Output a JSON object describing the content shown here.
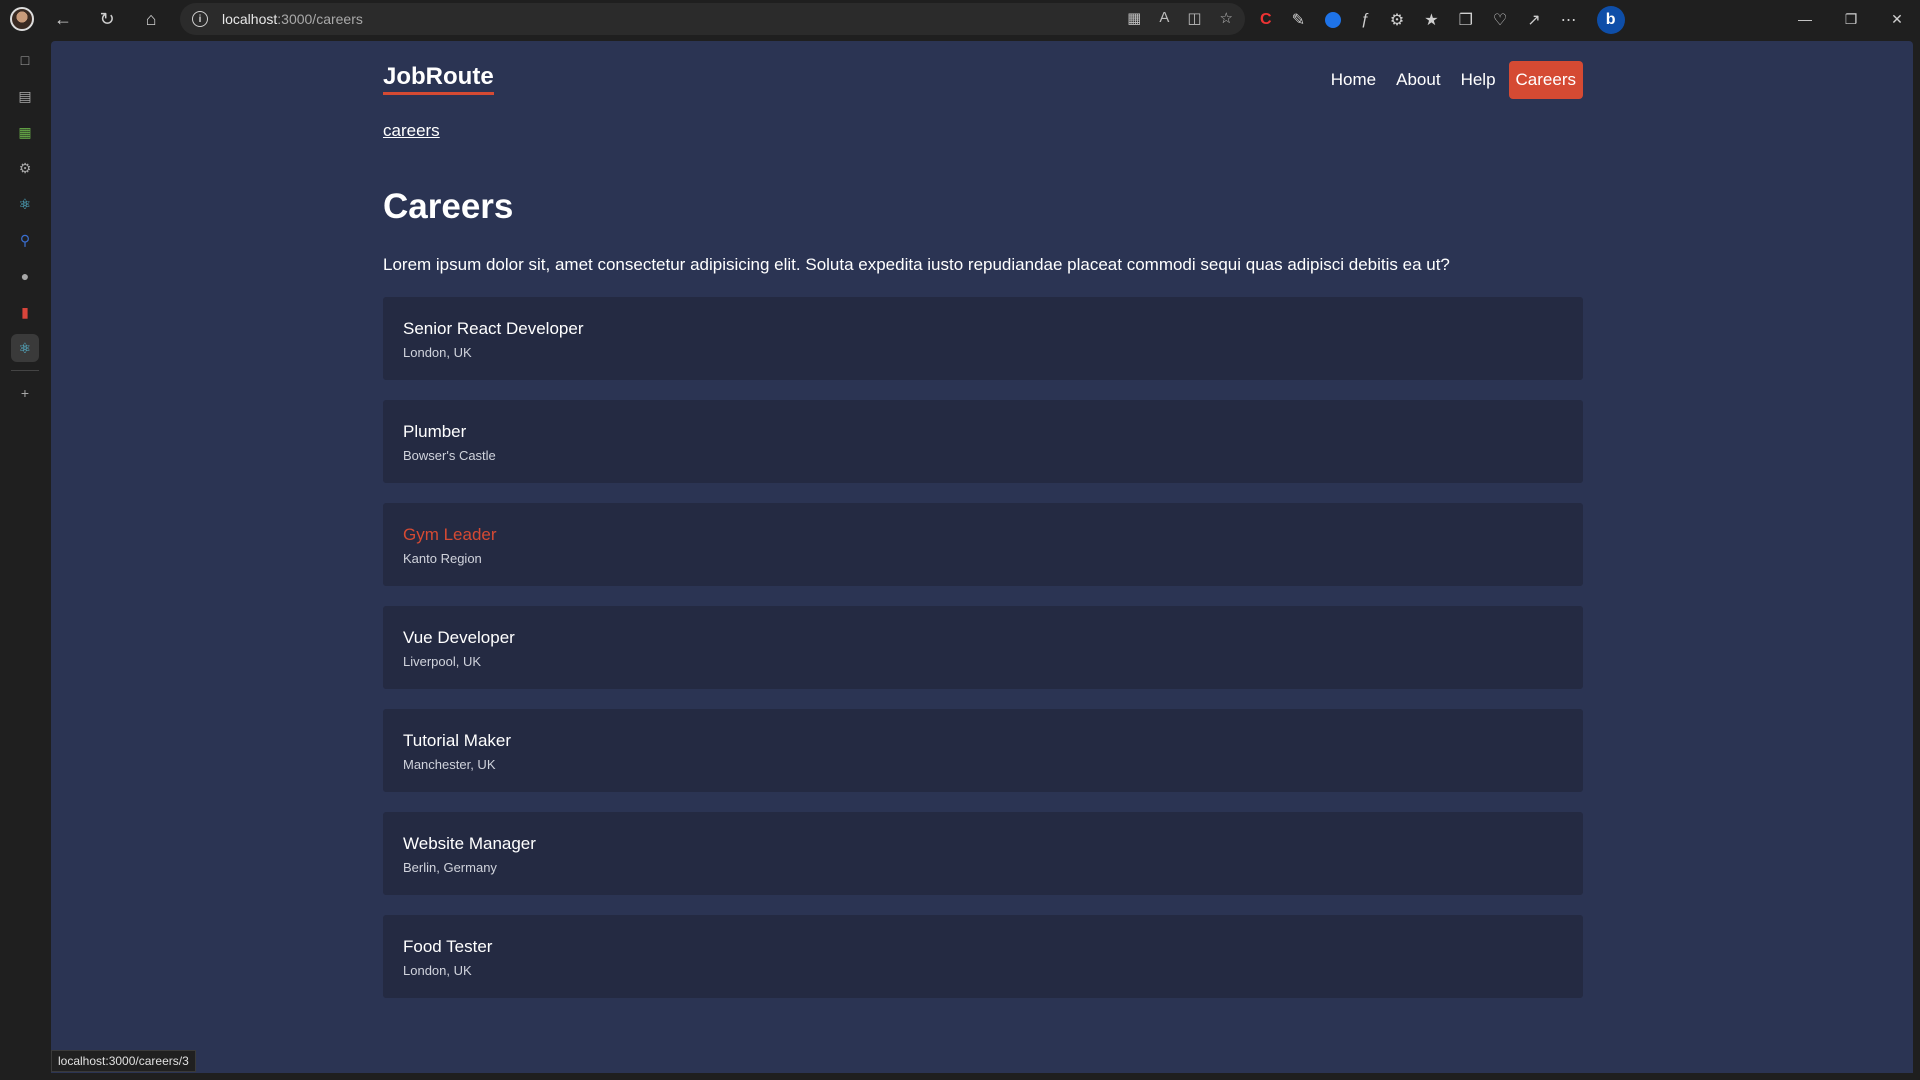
{
  "browser": {
    "url_host": "localhost",
    "url_path": ":3000/careers",
    "status_url": "localhost:3000/careers/3"
  },
  "site": {
    "logo": "JobRoute",
    "nav": [
      {
        "label": "Home"
      },
      {
        "label": "About"
      },
      {
        "label": "Help"
      },
      {
        "label": "Careers",
        "active": true
      }
    ],
    "breadcrumb": "careers",
    "accent_color": "#d54a33"
  },
  "page": {
    "title": "Careers",
    "lead": "Lorem ipsum dolor sit, amet consectetur adipisicing elit. Soluta expedita iusto repudiandae placeat commodi sequi quas adipisci debitis ea ut?"
  },
  "jobs": [
    {
      "title": "Senior React Developer",
      "location": "London, UK"
    },
    {
      "title": "Plumber",
      "location": "Bowser's Castle"
    },
    {
      "title": "Gym Leader",
      "location": "Kanto Region",
      "hovered": true
    },
    {
      "title": "Vue Developer",
      "location": "Liverpool, UK"
    },
    {
      "title": "Tutorial Maker",
      "location": "Manchester, UK"
    },
    {
      "title": "Website Manager",
      "location": "Berlin, Germany"
    },
    {
      "title": "Food Tester",
      "location": "London, UK"
    }
  ]
}
